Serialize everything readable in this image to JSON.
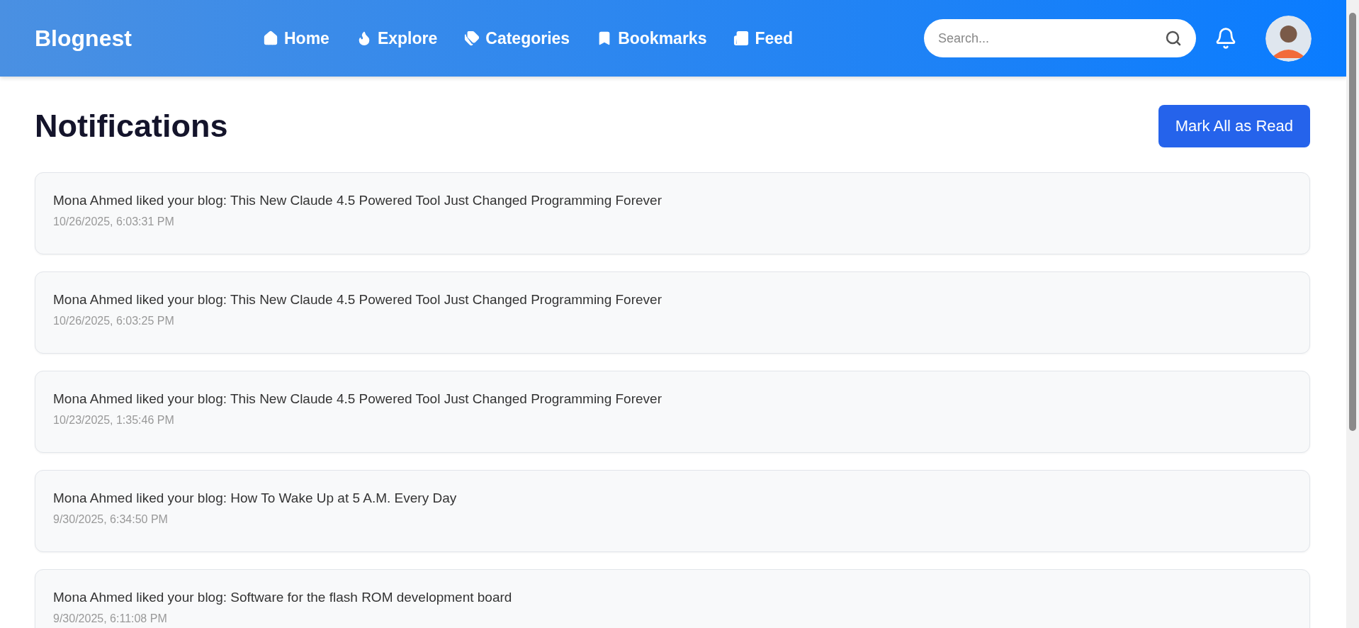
{
  "header": {
    "logo": "Blognest",
    "nav": [
      {
        "kind": "home",
        "label": "Home"
      },
      {
        "kind": "explore",
        "label": "Explore"
      },
      {
        "kind": "categories",
        "label": "Categories"
      },
      {
        "kind": "bookmarks",
        "label": "Bookmarks"
      },
      {
        "kind": "feed",
        "label": "Feed"
      }
    ],
    "search": {
      "placeholder": "Search..."
    }
  },
  "page": {
    "title": "Notifications",
    "action": "Mark All as Read"
  },
  "notifications": [
    {
      "message": "Mona Ahmed liked your blog: This New Claude 4.5 Powered Tool Just Changed Programming Forever",
      "time": "10/26/2025, 6:03:31 PM"
    },
    {
      "message": "Mona Ahmed liked your blog: This New Claude 4.5 Powered Tool Just Changed Programming Forever",
      "time": "10/26/2025, 6:03:25 PM"
    },
    {
      "message": "Mona Ahmed liked your blog: This New Claude 4.5 Powered Tool Just Changed Programming Forever",
      "time": "10/23/2025, 1:35:46 PM"
    },
    {
      "message": "Mona Ahmed liked your blog: How To Wake Up at 5 A.M. Every Day",
      "time": "9/30/2025, 6:34:50 PM"
    },
    {
      "message": "Mona Ahmed liked your blog: Software for the flash ROM development board",
      "time": "9/30/2025, 6:11:08 PM"
    }
  ]
}
